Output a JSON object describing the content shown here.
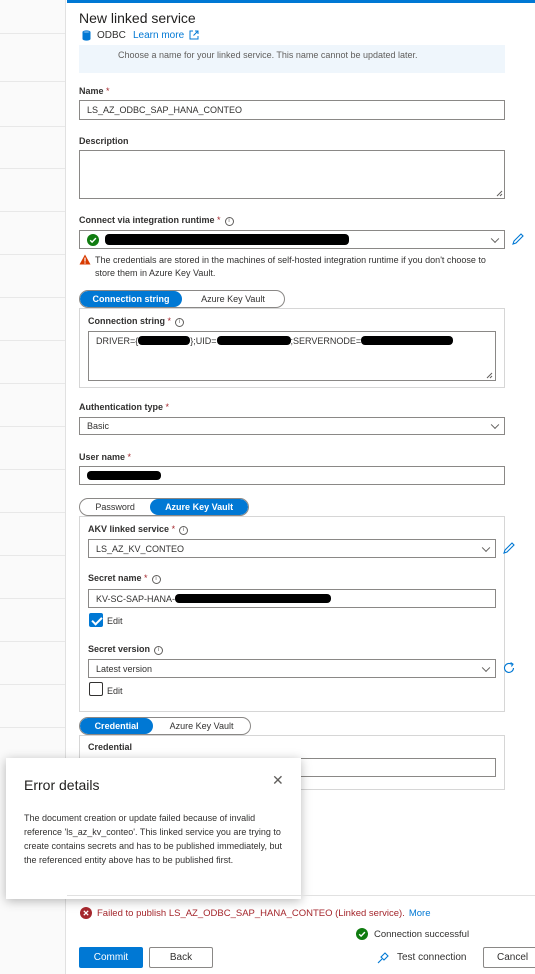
{
  "header": {
    "title": "New linked service",
    "type_label": "ODBC",
    "learn_more": "Learn more",
    "info_text": "Choose a name for your linked service. This name cannot be updated later."
  },
  "form": {
    "name_label": "Name",
    "name_value": "LS_AZ_ODBC_SAP_HANA_CONTEO",
    "description_label": "Description",
    "description_value": "",
    "runtime_label": "Connect via integration runtime",
    "runtime_warning": "The credentials are stored in the machines of self-hosted integration runtime if you don't choose to store them in Azure Key Vault.",
    "conn_toggle": [
      "Connection string",
      "Azure Key Vault"
    ],
    "conn_string_label": "Connection string",
    "conn_string_parts": [
      "DRIVER={",
      "};UID=",
      ";SERVERNODE="
    ],
    "auth_label": "Authentication type",
    "auth_value": "Basic",
    "user_label": "User name",
    "pwd_toggle": [
      "Password",
      "Azure Key Vault"
    ],
    "akv_label": "AKV linked service",
    "akv_value": "LS_AZ_KV_CONTEO",
    "secret_label": "Secret name",
    "secret_value": "KV-SC-SAP-HANA-",
    "edit_label": "Edit",
    "secret_version_label": "Secret version",
    "secret_version_value": "Latest version",
    "cred_toggle": [
      "Credential",
      "Azure Key Vault"
    ],
    "credential_label": "Credential",
    "required_mark": "*"
  },
  "error_panel": {
    "title": "Error details",
    "close": "✕",
    "body": "The document creation or update failed because of invalid reference 'ls_az_kv_conteo'. This linked service you are trying to create contains secrets and has to be published immediately, but the referenced entity above has to be published first."
  },
  "footer": {
    "fail_message": "Failed to publish LS_AZ_ODBC_SAP_HANA_CONTEO (Linked service).",
    "more": "More",
    "connection_status": "Connection successful",
    "commit": "Commit",
    "back": "Back",
    "test_connection": "Test connection",
    "cancel": "Cancel"
  },
  "colors": {
    "accent": "#0078d4",
    "error": "#a4262c",
    "success": "#107c10",
    "warning": "#d83b01"
  },
  "icons": {
    "database": "database-icon",
    "external": "external-link-icon",
    "check_circle": "check-circle-icon",
    "warning": "warning-icon",
    "pencil": "pencil-icon",
    "refresh": "refresh-icon",
    "error": "error-icon",
    "test": "test-connection-icon"
  }
}
